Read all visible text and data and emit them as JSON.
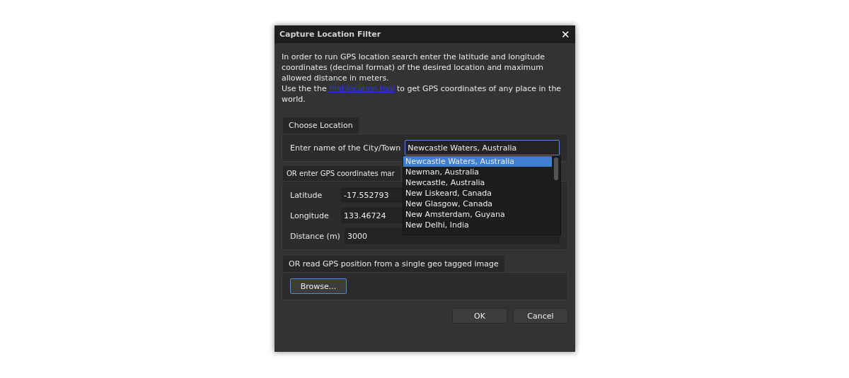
{
  "window": {
    "title": "Capture Location Filter",
    "close": "✕"
  },
  "intro": {
    "text": "In order to run GPS location search enter the latitude and longitude coordinates (decimal format) of the desired location and maximum allowed distance in meters.",
    "before": "Use the the ",
    "link": "find location tool",
    "after": " to get GPS coordinates of any place in the world."
  },
  "city_section": {
    "title": "Choose Location",
    "label": "Enter name of the City/Town",
    "value": "Newcastle Waters, Australia"
  },
  "suggestions": [
    {
      "label": "Newcastle Waters, Australia",
      "selected": true
    },
    {
      "label": "Newman, Australia",
      "selected": false
    },
    {
      "label": "Newcastle, Australia",
      "selected": false
    },
    {
      "label": "New Liskeard, Canada",
      "selected": false
    },
    {
      "label": "New Glasgow, Canada",
      "selected": false
    },
    {
      "label": "New Amsterdam, Guyana",
      "selected": false
    },
    {
      "label": "New Delhi, India",
      "selected": false
    }
  ],
  "gps_section": {
    "title": "OR enter GPS coordinates mar",
    "fields": [
      {
        "label": "Latitude",
        "value": "-17.552793"
      },
      {
        "label": "Longitude",
        "value": "133.46724"
      },
      {
        "label": "Distance (m)",
        "value": "3000"
      }
    ]
  },
  "image_section": {
    "title": "OR read GPS position from a single geo tagged image",
    "button": "Browse..."
  },
  "buttons": [
    "OK",
    "Cancel"
  ]
}
